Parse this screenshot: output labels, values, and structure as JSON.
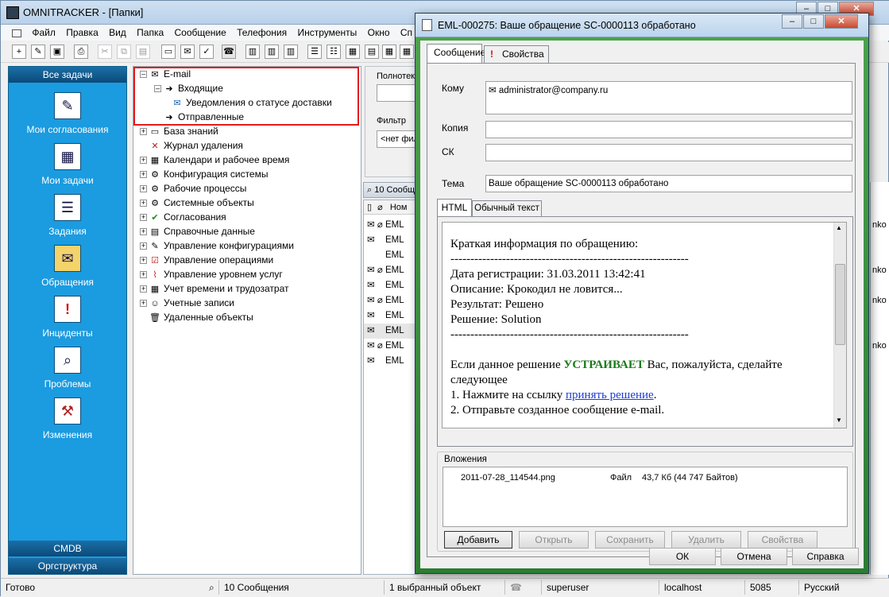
{
  "app": {
    "title": "OMNITRACKER - [Папки]"
  },
  "menu": [
    "Файл",
    "Правка",
    "Вид",
    "Папка",
    "Сообщение",
    "Телефония",
    "Инструменты",
    "Окно",
    "Сп"
  ],
  "taskpane": {
    "header": "Все задачи",
    "items": [
      {
        "label": "Мои согласования",
        "icon": "approval-icon"
      },
      {
        "label": "Мои задачи",
        "icon": "calendar-tasks-icon"
      },
      {
        "label": "Задания",
        "icon": "clipboard-icon"
      },
      {
        "label": "Обращения",
        "icon": "folder-icon"
      },
      {
        "label": "Инциденты",
        "icon": "incident-icon"
      },
      {
        "label": "Проблемы",
        "icon": "magnifier-icon"
      },
      {
        "label": "Изменения",
        "icon": "tools-icon"
      }
    ],
    "footer": [
      "CMDB",
      "Оргструктура"
    ]
  },
  "tree": {
    "email": "E-mail",
    "inbox": "Входящие",
    "delivery": "Уведомления о статусе доставки",
    "sent": "Отправленные",
    "items": [
      "База знаний",
      "Журнал удаления",
      "Календари и рабочее время",
      "Конфигурация системы",
      "Рабочие процессы",
      "Системные объекты",
      "Согласования",
      "Справочные данные",
      "Управление конфигурациями",
      "Управление операциями",
      "Управление уровнем услуг",
      "Учет времени и трудозатрат",
      "Учетные записи",
      "Удаленные объекты"
    ]
  },
  "middle": {
    "fulltext_label": "Полнотекс",
    "filter_label": "Фильтр",
    "filter_value": "<нет филь",
    "count_label": "10 Сообщ",
    "column_num": "Ном",
    "rows": [
      "EML",
      "EML",
      "EML",
      "EML",
      "EML",
      "EML",
      "EML",
      "EML",
      "EML",
      "EML"
    ],
    "right_fragments": [
      "nko",
      "nko",
      "nko",
      "nko"
    ]
  },
  "dialog": {
    "title": "EML-000275: Ваше обращение SC-0000113 обработано",
    "tabs": [
      "Сообщение",
      "Свойства"
    ],
    "to_label": "Кому",
    "to_value": "administrator@company.ru",
    "cc_label": "Копия",
    "bcc_label": "СК",
    "subject_label": "Тема",
    "subject_value": "Ваше обращение SC-0000113 обработано",
    "body_tabs": [
      "HTML",
      "Обычный текст"
    ],
    "body": {
      "line1": "Краткая информация по обращению:",
      "sep": "------------------------------------------------------------",
      "line2": "Дата регистрации: 31.03.2011 13:42:41",
      "line3": "Описание: Крокодил не ловится...",
      "line4": "Результат: Решено",
      "line5": "Решение: Solution",
      "line6a": "Если данное решение ",
      "line6b": "УСТРАИВАЕТ",
      "line6c": " Вас, пожалуйста, сделайте следующее",
      "line7a": "1. Нажмите на ссылку ",
      "line7b": "принять решение",
      "line7c": ".",
      "line8": "2. Отправьте созданное сообщение e-mail."
    },
    "attachments_label": "Вложения",
    "attachment": {
      "name": "2011-07-28_114544.png",
      "type": "Файл",
      "size": "43,7 Кб (44 747 Байтов)"
    },
    "attach_buttons": [
      "Добавить",
      "Открыть",
      "Сохранить",
      "Удалить",
      "Свойства"
    ],
    "buttons": {
      "ok": "ОК",
      "cancel": "Отмена",
      "help": "Справка"
    }
  },
  "status": {
    "ready": "Готово",
    "messages": "10 Сообщения",
    "selected": "1 выбранный объект",
    "user": "superuser",
    "host": "localhost",
    "port": "5085",
    "lang": "Русский"
  },
  "colors": {
    "accent": "#1b9be0",
    "highlight": "#e21b1b",
    "dialog_frame": "#2b7d33"
  }
}
